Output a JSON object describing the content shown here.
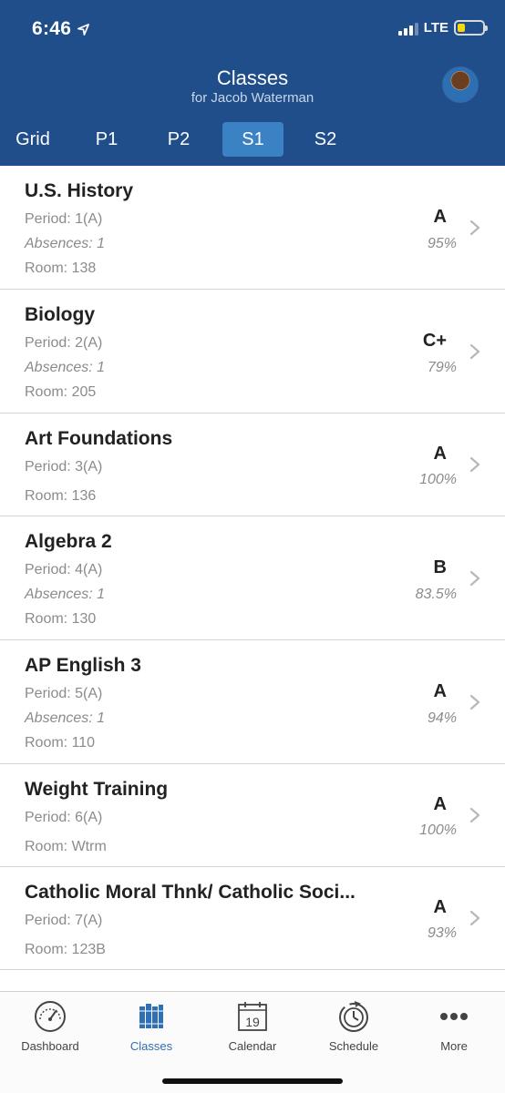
{
  "status": {
    "time": "6:46",
    "network": "LTE",
    "battery_level": 0.3
  },
  "header": {
    "title": "Classes",
    "subtitle": "for Jacob Waterman"
  },
  "tabs": [
    {
      "label": "Grid"
    },
    {
      "label": "P1"
    },
    {
      "label": "P2"
    },
    {
      "label": "S1",
      "active": true
    },
    {
      "label": "S2"
    }
  ],
  "classes": [
    {
      "name": "U.S. History",
      "period": "Period: 1(A)",
      "absences": "Absences: 1",
      "room": "Room: 138",
      "grade": "A",
      "percent": "95%"
    },
    {
      "name": "Biology",
      "period": "Period: 2(A)",
      "absences": "Absences: 1",
      "room": "Room: 205",
      "grade": "C+",
      "percent": "79%"
    },
    {
      "name": "Art Foundations",
      "period": "Period: 3(A)",
      "room": "Room: 136",
      "grade": "A",
      "percent": "100%"
    },
    {
      "name": "Algebra 2",
      "period": "Period: 4(A)",
      "absences": "Absences: 1",
      "room": "Room: 130",
      "grade": "B",
      "percent": "83.5%"
    },
    {
      "name": "AP English 3",
      "period": "Period: 5(A)",
      "absences": "Absences: 1",
      "room": "Room: 110",
      "grade": "A",
      "percent": "94%"
    },
    {
      "name": "Weight Training",
      "period": "Period: 6(A)",
      "room": "Room: Wtrm",
      "grade": "A",
      "percent": "100%"
    },
    {
      "name": "Catholic Moral Thnk/ Catholic Soci...",
      "period": "Period: 7(A)",
      "room": "Room: 123B",
      "grade": "A",
      "percent": "93%"
    }
  ],
  "tabbar": {
    "items": [
      {
        "label": "Dashboard",
        "icon": "dashboard-gauge-icon"
      },
      {
        "label": "Classes",
        "icon": "books-icon",
        "active": true
      },
      {
        "label": "Calendar",
        "icon": "calendar-icon",
        "day": "19"
      },
      {
        "label": "Schedule",
        "icon": "schedule-clock-icon"
      },
      {
        "label": "More",
        "icon": "more-dots-icon"
      }
    ]
  },
  "colors": {
    "header_bg": "#1f4e8a",
    "active_tab": "#3b82c4",
    "accent": "#2f6fb5"
  }
}
